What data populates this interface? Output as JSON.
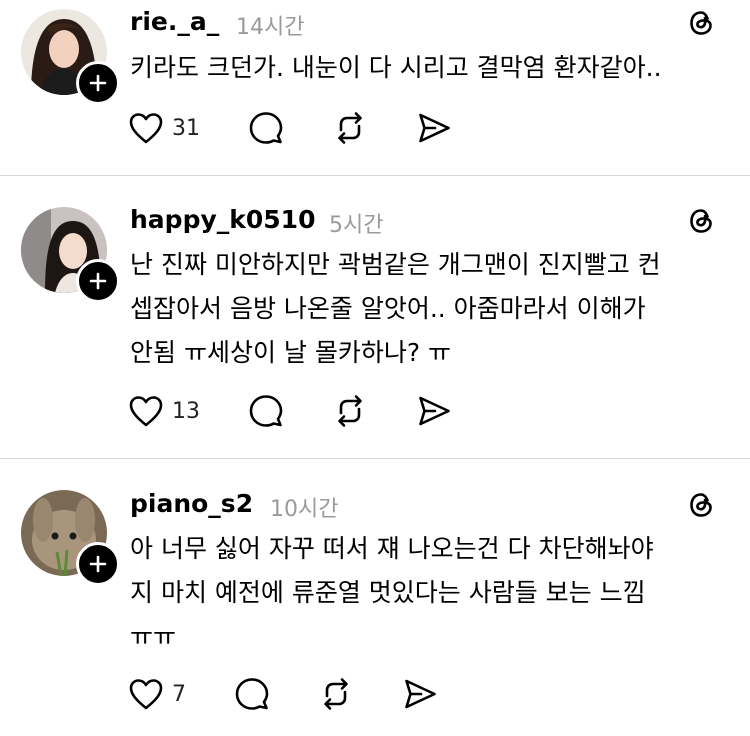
{
  "posts": [
    {
      "username": "rie._a_",
      "time": "14시간",
      "text": "키라도 크던가. 내눈이 다 시리고 결막염 환자같아..",
      "likes": "31",
      "avatar_icon": "profile-photo-woman-dark-hair"
    },
    {
      "username": "happy_k0510",
      "time": "5시간",
      "text": "난 진짜 미안하지만 곽범같은 개그맨이 진지빨고 컨\n셉잡아서 음방 나온줄 알앗어.. 아줌마라서 이해가\n안됨 ㅠ세상이 날 몰카하나? ㅠ",
      "likes": "13",
      "avatar_icon": "profile-photo-woman-selfie"
    },
    {
      "username": "piano_s2",
      "time": "10시간",
      "text": "아 너무 싫어 자꾸 떠서 쟤 나오는건 다 차단해놔야\n지 마치 예전에 류준열 멋있다는 사람들 보는 느낌\nㅠㅠ",
      "likes": "7",
      "avatar_icon": "profile-photo-rabbit"
    }
  ],
  "colors": {
    "text": "#000000",
    "muted": "#9a9a9a",
    "divider": "#d9d9d9"
  },
  "icons": [
    "heart-icon",
    "comment-icon",
    "repost-icon",
    "share-icon",
    "threads-logo-icon",
    "follow-plus-icon"
  ]
}
